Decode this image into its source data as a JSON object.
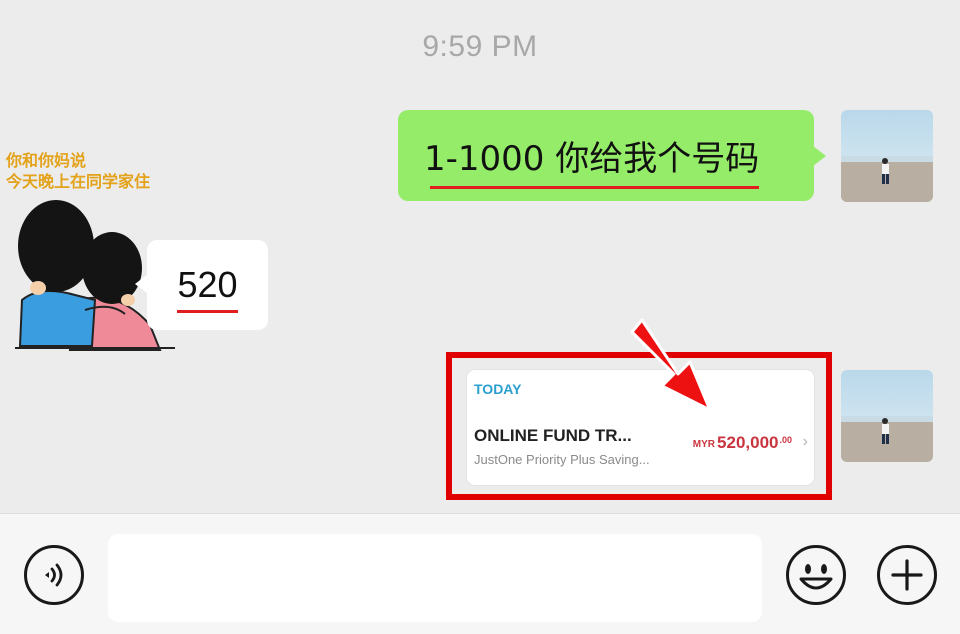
{
  "chat": {
    "timestamp": "9:59 PM",
    "outgoing_message": "1-1000 你给我个号码",
    "sticker": {
      "caption_line1": "你和你妈说",
      "caption_line2": "今天晚上在同学家住"
    },
    "incoming_message": "520"
  },
  "transfer_card": {
    "label": "TODAY",
    "title": "ONLINE FUND TR...",
    "subtitle": "JustOne Priority Plus Saving...",
    "currency": "MYR",
    "amount": "520,000",
    "amount_decimals": ".00"
  },
  "input_bar": {
    "voice_icon": "voice-icon",
    "emoji_icon": "emoji-icon",
    "add_icon": "plus-icon",
    "message_value": ""
  },
  "colors": {
    "outgoing_bubble": "#95ec69",
    "annotation_red": "#e00000",
    "amount_red": "#c9353f",
    "today_blue": "#2a9fd0"
  }
}
